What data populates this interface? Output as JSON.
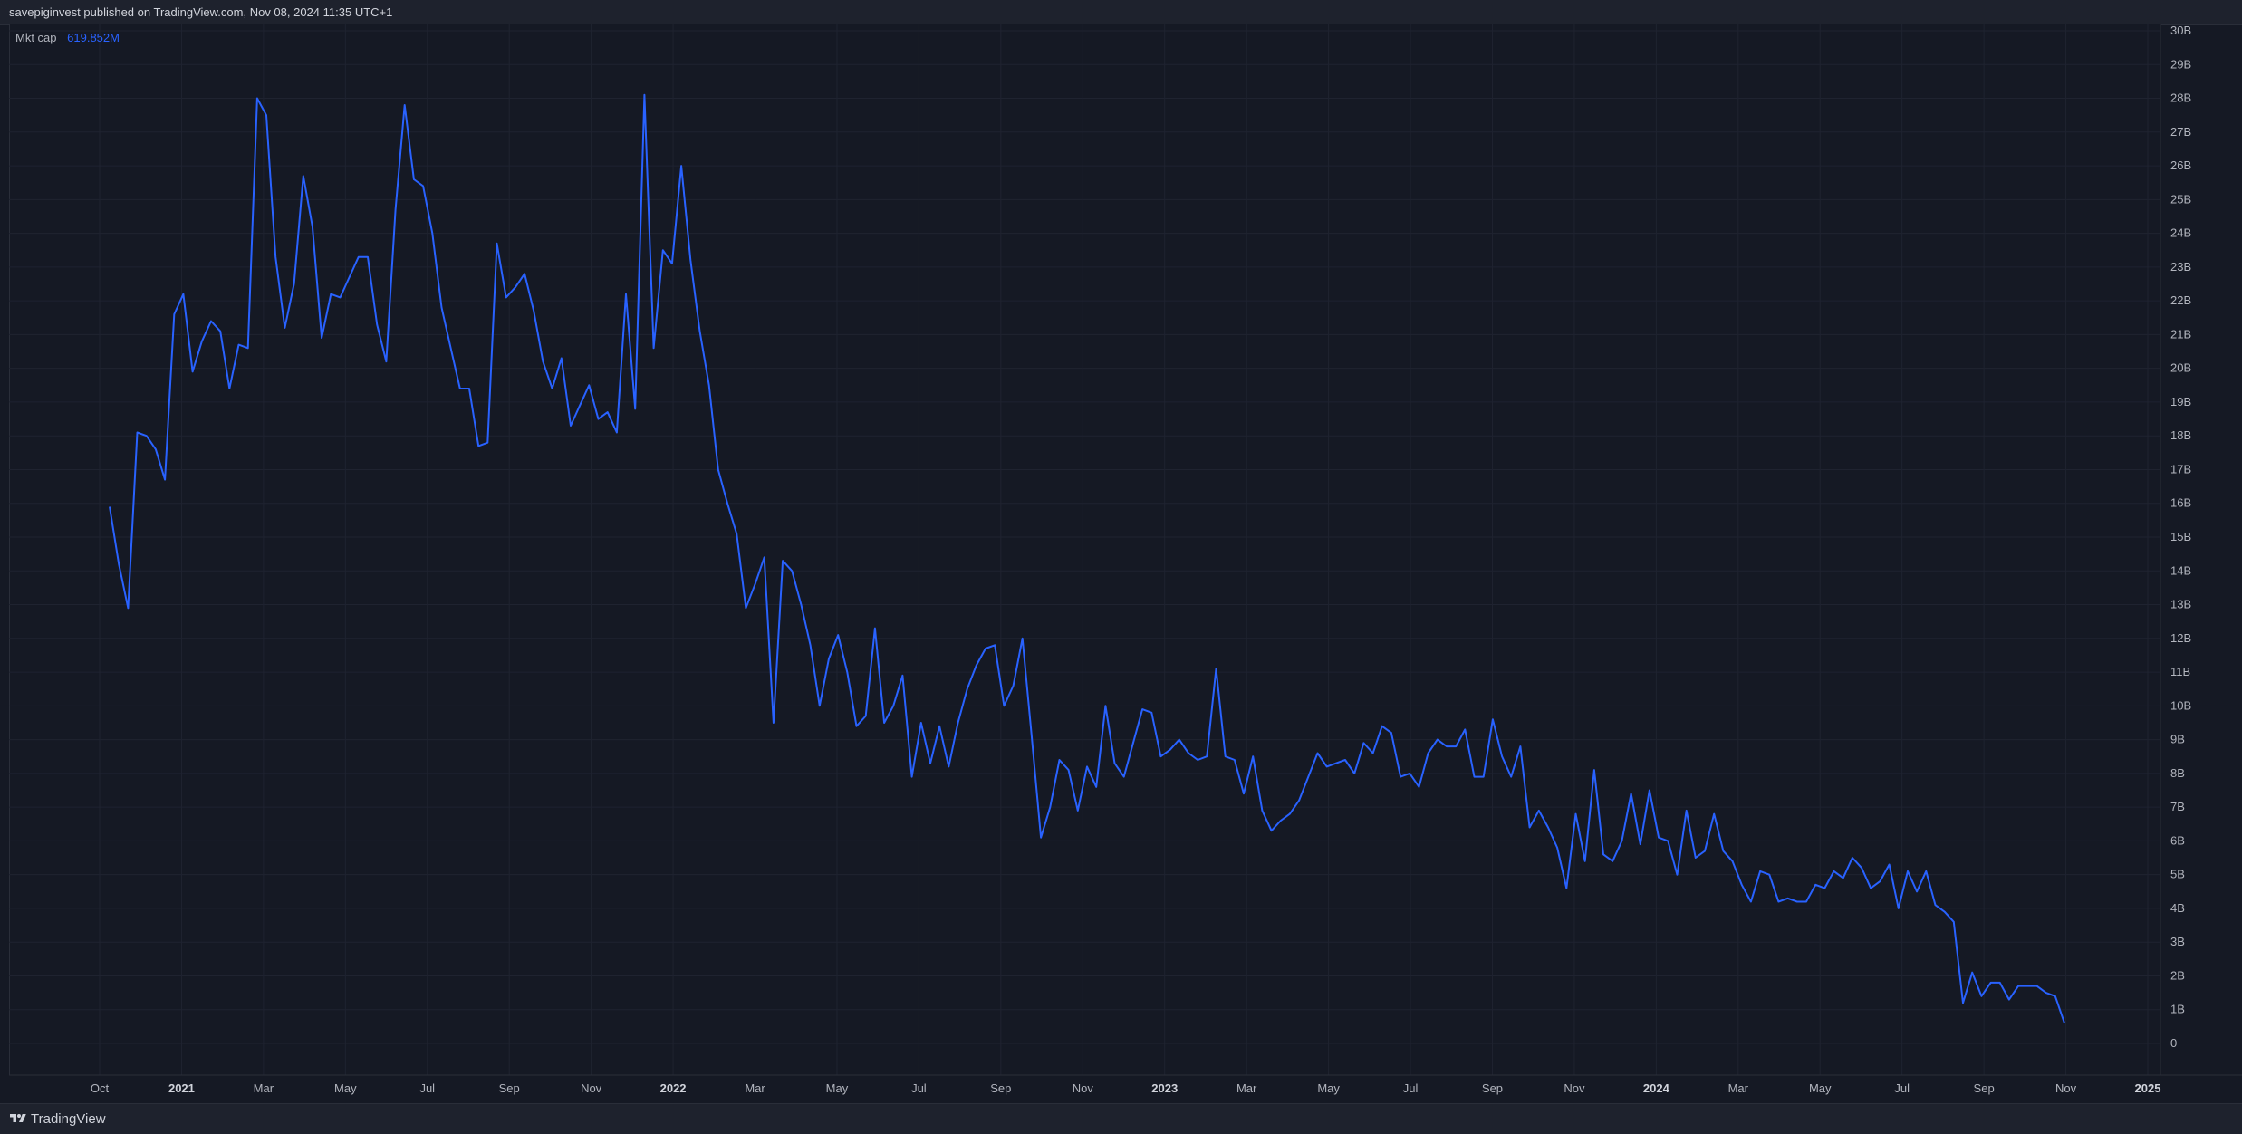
{
  "header": {
    "publisher_text": "savepiginvest published on TradingView.com, Nov 08, 2024 11:35 UTC+1"
  },
  "legend": {
    "name": "Mkt cap",
    "value": "619.852M"
  },
  "footer": {
    "brand": "TradingView"
  },
  "colors": {
    "background": "#151924",
    "line": "#2962ff",
    "grid": "#1f2330"
  },
  "chart_data": {
    "type": "line",
    "ylim": [
      0,
      30
    ],
    "y_ticks": [
      "0",
      "1B",
      "2B",
      "3B",
      "4B",
      "5B",
      "6B",
      "7B",
      "8B",
      "9B",
      "10B",
      "11B",
      "12B",
      "13B",
      "14B",
      "15B",
      "16B",
      "17B",
      "18B",
      "19B",
      "20B",
      "21B",
      "22B",
      "23B",
      "24B",
      "25B",
      "26B",
      "27B",
      "28B",
      "29B",
      "30B"
    ],
    "x_ticks": [
      {
        "label": "Oct",
        "major": false
      },
      {
        "label": "2021",
        "major": true
      },
      {
        "label": "Mar",
        "major": false
      },
      {
        "label": "May",
        "major": false
      },
      {
        "label": "Jul",
        "major": false
      },
      {
        "label": "Sep",
        "major": false
      },
      {
        "label": "Nov",
        "major": false
      },
      {
        "label": "2022",
        "major": true
      },
      {
        "label": "Mar",
        "major": false
      },
      {
        "label": "May",
        "major": false
      },
      {
        "label": "Jul",
        "major": false
      },
      {
        "label": "Sep",
        "major": false
      },
      {
        "label": "Nov",
        "major": false
      },
      {
        "label": "2023",
        "major": true
      },
      {
        "label": "Mar",
        "major": false
      },
      {
        "label": "May",
        "major": false
      },
      {
        "label": "Jul",
        "major": false
      },
      {
        "label": "Sep",
        "major": false
      },
      {
        "label": "Nov",
        "major": false
      },
      {
        "label": "2024",
        "major": true
      },
      {
        "label": "Mar",
        "major": false
      },
      {
        "label": "May",
        "major": false
      },
      {
        "label": "Jul",
        "major": false
      },
      {
        "label": "Sep",
        "major": false
      },
      {
        "label": "Nov",
        "major": false
      },
      {
        "label": "2025",
        "major": true
      }
    ],
    "series": [
      {
        "values": [
          15.9,
          14.2,
          12.9,
          18.1,
          18.0,
          17.6,
          16.7,
          21.6,
          22.2,
          19.9,
          20.8,
          21.4,
          21.1,
          19.4,
          20.7,
          20.6,
          28.0,
          27.5,
          23.3,
          21.2,
          22.5,
          25.7,
          24.2,
          20.9,
          22.2,
          22.1,
          22.7,
          23.3,
          23.3,
          21.3,
          20.2,
          24.7,
          27.8,
          25.6,
          25.4,
          24.0,
          21.8,
          20.6,
          19.4,
          19.4,
          17.7,
          17.8,
          23.7,
          22.1,
          22.4,
          22.8,
          21.7,
          20.2,
          19.4,
          20.3,
          18.3,
          18.9,
          19.5,
          18.5,
          18.7,
          18.1,
          22.2,
          18.8,
          28.1,
          20.6,
          23.5,
          23.1,
          26.0,
          23.2,
          21.1,
          19.5,
          17.0,
          16.0,
          15.1,
          12.9,
          13.6,
          14.4,
          9.5,
          14.3,
          14.0,
          13.0,
          11.8,
          10.0,
          11.4,
          12.1,
          11.0,
          9.4,
          9.7,
          12.3,
          9.5,
          10.0,
          10.9,
          7.9,
          9.5,
          8.3,
          9.4,
          8.2,
          9.5,
          10.5,
          11.2,
          11.7,
          11.8,
          10.0,
          10.6,
          12.0,
          9.1,
          6.1,
          7.0,
          8.4,
          8.1,
          6.9,
          8.2,
          7.6,
          10.0,
          8.3,
          7.9,
          8.9,
          9.9,
          9.8,
          8.5,
          8.7,
          9.0,
          8.6,
          8.4,
          8.5,
          11.1,
          8.5,
          8.4,
          7.4,
          8.5,
          6.9,
          6.3,
          6.6,
          6.8,
          7.2,
          7.9,
          8.6,
          8.2,
          8.3,
          8.4,
          8.0,
          8.9,
          8.6,
          9.4,
          9.2,
          7.9,
          8.0,
          7.6,
          8.6,
          9.0,
          8.8,
          8.8,
          9.3,
          7.9,
          7.9,
          9.6,
          8.5,
          7.9,
          8.8,
          6.4,
          6.9,
          6.4,
          5.8,
          4.6,
          6.8,
          5.4,
          8.1,
          5.6,
          5.4,
          6.0,
          7.4,
          5.9,
          7.5,
          6.1,
          6.0,
          5.0,
          6.9,
          5.5,
          5.7,
          6.8,
          5.7,
          5.4,
          4.7,
          4.2,
          5.1,
          5.0,
          4.2,
          4.3,
          4.2,
          4.2,
          4.7,
          4.6,
          5.1,
          4.9,
          5.5,
          5.2,
          4.6,
          4.8,
          5.3,
          4.0,
          5.1,
          4.5,
          5.1,
          4.1,
          3.9,
          3.6,
          1.2,
          2.1,
          1.4,
          1.8,
          1.8,
          1.3,
          1.7,
          1.7,
          1.7,
          1.5,
          1.4,
          0.6
        ]
      }
    ]
  }
}
